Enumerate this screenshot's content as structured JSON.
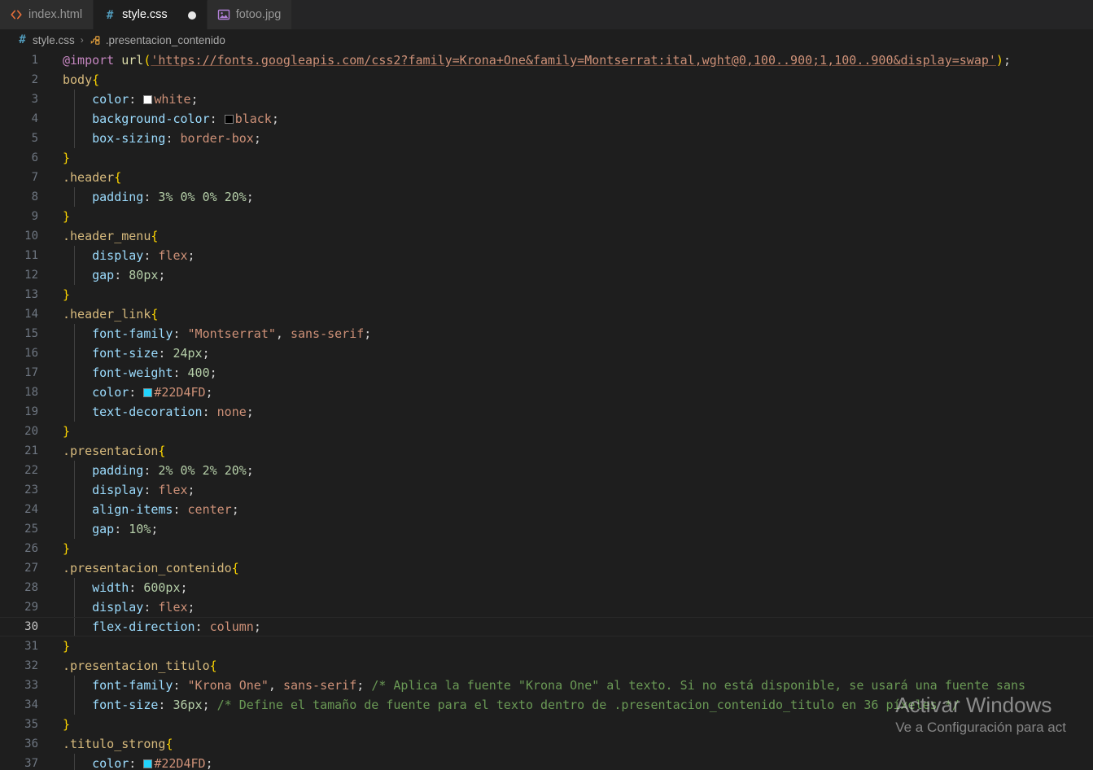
{
  "tabs": [
    {
      "label": "index.html",
      "icon": "html-file-icon",
      "active": false,
      "dirty": false
    },
    {
      "label": "style.css",
      "icon": "css-file-icon",
      "active": true,
      "dirty": true
    },
    {
      "label": "fotoo.jpg",
      "icon": "image-file-icon",
      "active": false,
      "dirty": false
    }
  ],
  "breadcrumb": {
    "file": "style.css",
    "separator": "›",
    "symbol": ".presentacion_contenido",
    "file_icon": "css-file-icon",
    "symbol_icon": "css-rule-icon"
  },
  "editor": {
    "language": "css",
    "current_line": 30,
    "first_line": 1,
    "last_line": 37,
    "lines": [
      {
        "n": 1,
        "text": "@import url('https://fonts.googleapis.com/css2?family=Krona+One&family=Montserrat:ital,wght@0,100..900;1,100..900&display=swap');"
      },
      {
        "n": 2,
        "text": "body{"
      },
      {
        "n": 3,
        "text": "    color: white;"
      },
      {
        "n": 4,
        "text": "    background-color: black;"
      },
      {
        "n": 5,
        "text": "    box-sizing: border-box;"
      },
      {
        "n": 6,
        "text": "}"
      },
      {
        "n": 7,
        "text": ".header{"
      },
      {
        "n": 8,
        "text": "    padding: 3% 0% 0% 20%;"
      },
      {
        "n": 9,
        "text": "}"
      },
      {
        "n": 10,
        "text": ".header_menu{"
      },
      {
        "n": 11,
        "text": "    display: flex;"
      },
      {
        "n": 12,
        "text": "    gap: 80px;"
      },
      {
        "n": 13,
        "text": "}"
      },
      {
        "n": 14,
        "text": ".header_link{"
      },
      {
        "n": 15,
        "text": "    font-family: \"Montserrat\", sans-serif;"
      },
      {
        "n": 16,
        "text": "    font-size: 24px;"
      },
      {
        "n": 17,
        "text": "    font-weight: 400;"
      },
      {
        "n": 18,
        "text": "    color: #22D4FD;"
      },
      {
        "n": 19,
        "text": "    text-decoration: none;"
      },
      {
        "n": 20,
        "text": "}"
      },
      {
        "n": 21,
        "text": ".presentacion{"
      },
      {
        "n": 22,
        "text": "    padding: 2% 0% 2% 20%;"
      },
      {
        "n": 23,
        "text": "    display: flex;"
      },
      {
        "n": 24,
        "text": "    align-items: center;"
      },
      {
        "n": 25,
        "text": "    gap: 10%;"
      },
      {
        "n": 26,
        "text": "}"
      },
      {
        "n": 27,
        "text": ".presentacion_contenido{"
      },
      {
        "n": 28,
        "text": "    width: 600px;"
      },
      {
        "n": 29,
        "text": "    display: flex;"
      },
      {
        "n": 30,
        "text": "    flex-direction: column;"
      },
      {
        "n": 31,
        "text": "}"
      },
      {
        "n": 32,
        "text": ".presentacion_titulo{"
      },
      {
        "n": 33,
        "text": "    font-family: \"Krona One\", sans-serif; /* Aplica la fuente \"Krona One\" al texto. Si no está disponible, se usará una fuente sans"
      },
      {
        "n": 34,
        "text": "    font-size: 36px; /* Define el tamaño de fuente para el texto dentro de .presentacion_contenido_titulo en 36 píxeles */"
      },
      {
        "n": 35,
        "text": "}"
      },
      {
        "n": 36,
        "text": ".titulo_strong{"
      },
      {
        "n": 37,
        "text": "    color: #22D4FD;"
      }
    ],
    "color_swatches": {
      "white": "#ffffff",
      "black": "#000000",
      "accent": "#22D4FD"
    }
  },
  "watermark": {
    "title": "Activar Windows",
    "subtitle": "Ve a Configuración para act"
  },
  "theme": {
    "editor_bg": "#1e1e1e",
    "tabbar_bg": "#252526",
    "inactive_tab_bg": "#2d2d2d",
    "line_number": "#6e7681",
    "comment": "#6a9955",
    "property": "#9cdcfe",
    "value": "#ce9178",
    "number": "#b5cea8",
    "selector": "#d7ba7d",
    "brace": "#ffd700"
  }
}
